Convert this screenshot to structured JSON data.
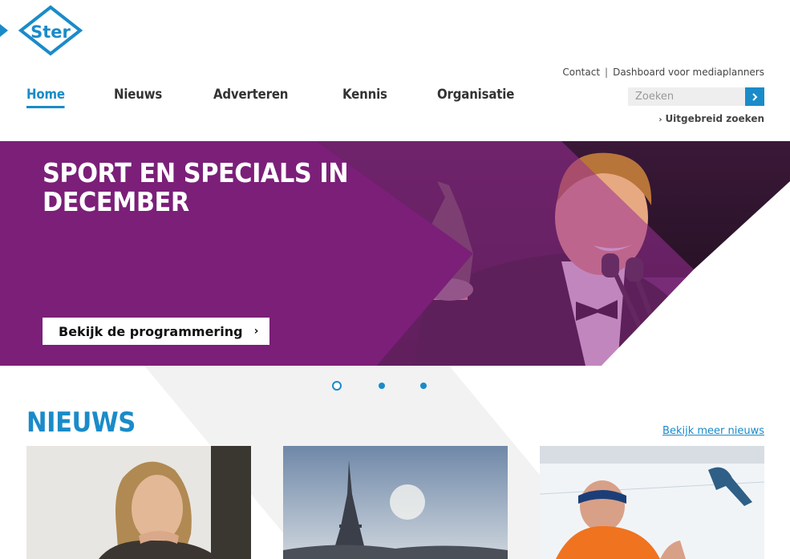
{
  "logo": {
    "text": "Ster"
  },
  "top_links": {
    "contact": "Contact",
    "separator": "|",
    "dashboard": "Dashboard voor mediaplanners"
  },
  "nav": {
    "items": [
      {
        "label": "Home",
        "active": true
      },
      {
        "label": "Nieuws",
        "active": false
      },
      {
        "label": "Adverteren",
        "active": false
      },
      {
        "label": "Kennis",
        "active": false
      },
      {
        "label": "Organisatie",
        "active": false
      }
    ]
  },
  "search": {
    "placeholder": "Zoeken",
    "button_icon": "arrow-right-icon",
    "advanced_label": "Uitgebreid zoeken"
  },
  "hero": {
    "title": "SPORT EN SPECIALS IN DECEMBER",
    "cta_label": "Bekijk de programmering",
    "background_color": "#7b1f79"
  },
  "carousel": {
    "slide_count": 3,
    "active_index": 0
  },
  "news": {
    "title": "NIEUWS",
    "more_link": "Bekijk meer nieuws",
    "cards": [
      {
        "image": "woman-portrait-photo"
      },
      {
        "image": "eiffel-tower-photo"
      },
      {
        "image": "speed-skater-photo"
      }
    ]
  },
  "colors": {
    "accent": "#1a8bc9",
    "hero_purple": "#7b1f79"
  }
}
